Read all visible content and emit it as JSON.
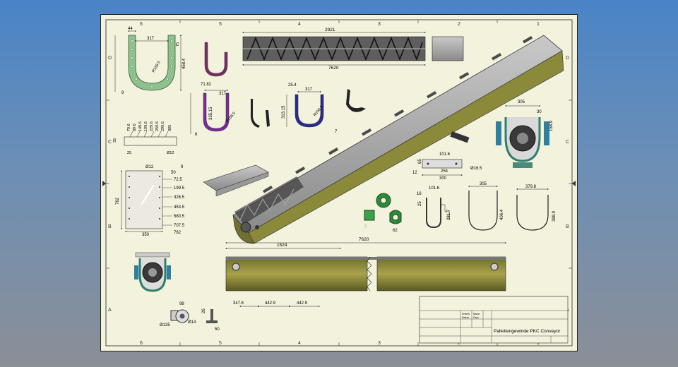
{
  "zones": {
    "columns": [
      "6",
      "5",
      "4",
      "3",
      "2",
      "1"
    ],
    "rows": [
      "D",
      "C",
      "B",
      "A"
    ]
  },
  "title_block": {
    "drawing_title": "Pallettengewinde PKC Conveyor",
    "small_fields": [
      "Erstellt",
      "Datum",
      "Name",
      "Gepr."
    ]
  },
  "dimensions": {
    "u_trough": {
      "width": "44",
      "inner": "317",
      "radius": "R158.5",
      "height": "458.4",
      "flange": "75",
      "bolt": "9"
    },
    "top_screw": {
      "length": "2921",
      "overall": "7620"
    },
    "purple_trough": {
      "a": "71.82",
      "b": "317",
      "h": "335.15",
      "r": "R158.5",
      "foot": "6"
    },
    "blue_trough": {
      "a": "25.4",
      "b": "317",
      "h": "313.15",
      "r": "R158.5",
      "foot": "7"
    },
    "hanger_bracket": {
      "values": [
        "79.6",
        "89.6",
        "149.6",
        "199.6",
        "229.6",
        "259.6",
        "299.6",
        "395"
      ],
      "c1": "35",
      "c2": "25",
      "hole": "Ø12"
    },
    "plate": {
      "hole": "Ø12",
      "top": "50",
      "side": "9",
      "stations": [
        "72.5",
        "199.5",
        "326.5",
        "453.5",
        "580.5",
        "707.5",
        "762"
      ],
      "height": "762",
      "width": "350"
    },
    "end_view": {
      "w": "305",
      "d": "30",
      "h": "158.9"
    },
    "flat_bar": {
      "a": "101.6",
      "b": "254",
      "c": "300",
      "hole": "Ø16.5",
      "h": "65",
      "t": "12"
    },
    "u_bolt": {
      "a": "101.6",
      "b": "16",
      "c": "281.7",
      "d": "25"
    },
    "clamp": {
      "d": "62"
    },
    "liner_1": {
      "w": "305",
      "h": "406.4"
    },
    "liner_2": {
      "w": "379.8",
      "h": "398.9"
    },
    "main_side": {
      "overall": "7620",
      "section": "1524",
      "d1": "347.6",
      "d2": "442.9",
      "d3": "442.9"
    },
    "flange_view": {
      "d": "98",
      "pcd": "Ø135",
      "hole": "Ø14"
    },
    "foot": {
      "w": "50",
      "h": "26"
    }
  }
}
